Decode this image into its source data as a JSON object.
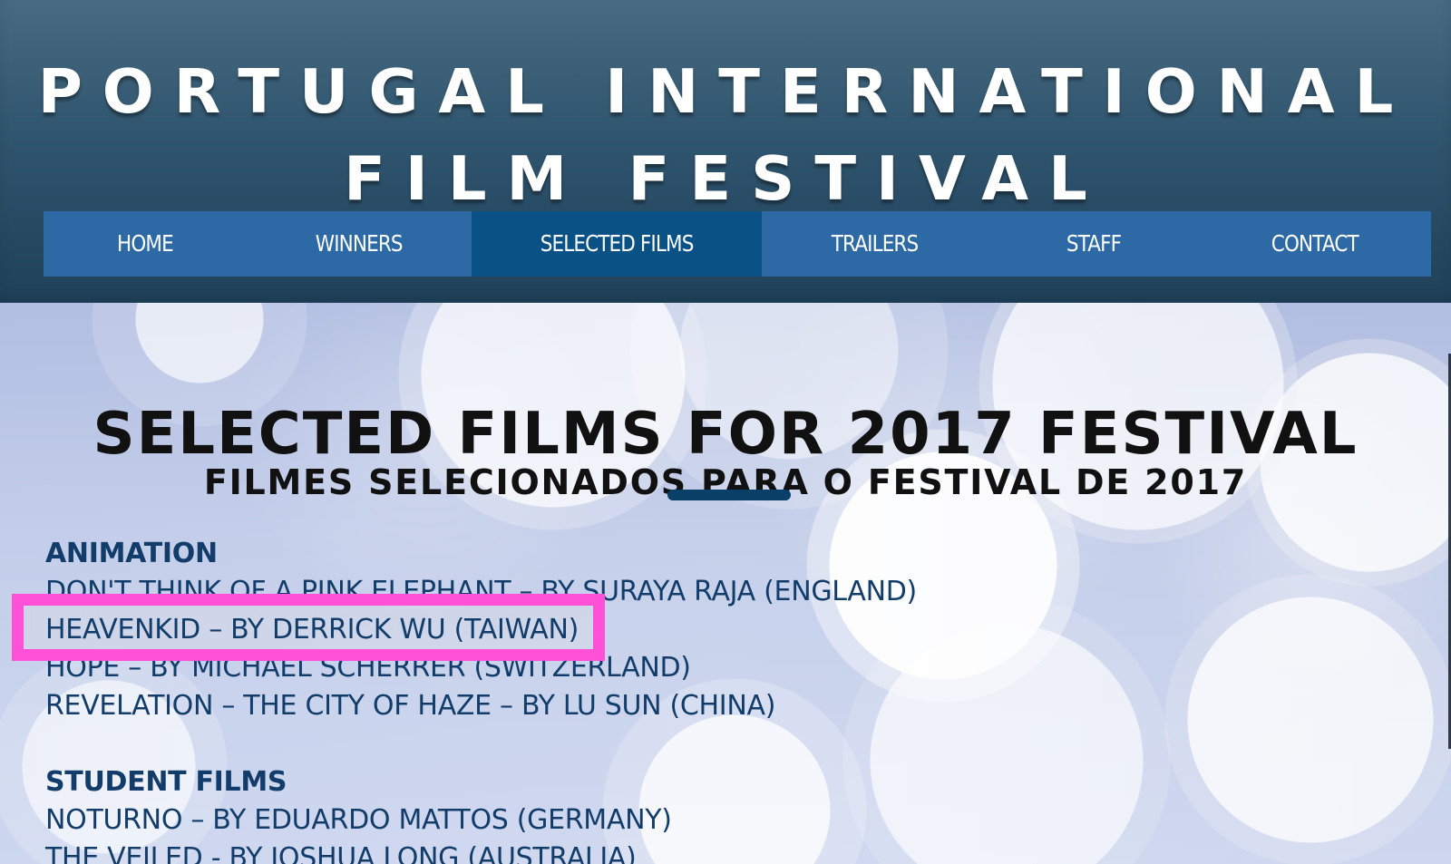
{
  "site": {
    "title_line_1": "PORTUGAL INTERNATIONAL",
    "title_line_2": "FILM FESTIVAL"
  },
  "nav": {
    "items": [
      {
        "label": "HOME",
        "active": false
      },
      {
        "label": "WINNERS",
        "active": false
      },
      {
        "label": "SELECTED FILMS",
        "active": true
      },
      {
        "label": "TRAILERS",
        "active": false
      },
      {
        "label": "STAFF",
        "active": false
      },
      {
        "label": "CONTACT",
        "active": false
      }
    ]
  },
  "main": {
    "title": "SELECTED FILMS FOR 2017 FESTIVAL",
    "subtitle": "FILMES SELECIONADOS PARA O FESTIVAL DE 2017",
    "sections": [
      {
        "title": "ANIMATION",
        "films": [
          "DON'T THINK OF A PINK ELEPHANT – BY SURAYA RAJA (ENGLAND)",
          "HEAVENKID – BY DERRICK WU (TAIWAN)",
          "HOPE – BY MICHAEL SCHERRER (SWITZERLAND)",
          "REVELATION – THE CITY OF HAZE – BY LU SUN (CHINA)"
        ]
      },
      {
        "title": "STUDENT FILMS",
        "films": [
          "NOTURNO – BY EDUARDO MATTOS (GERMANY)",
          "THE VEILED - BY JOSHUA LONG (AUSTRALIA)"
        ]
      }
    ],
    "highlighted_film": "HEAVENKID – BY DERRICK WU (TAIWAN)"
  },
  "colors": {
    "header": "#2f536b",
    "nav": "#2d69a5",
    "nav_active": "#0a5186",
    "film_text": "#123c69",
    "highlight": "#ff50d8"
  }
}
